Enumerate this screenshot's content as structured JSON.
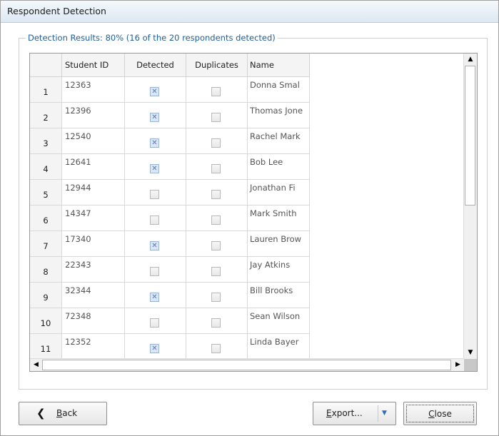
{
  "window": {
    "title": "Respondent Detection"
  },
  "group": {
    "legend": "Detection Results: 80% (16 of the 20 respondents detected)"
  },
  "table": {
    "headers": {
      "row_num": "",
      "student_id": "Student ID",
      "detected": "Detected",
      "duplicates": "Duplicates",
      "name": "Name"
    },
    "rows": [
      {
        "n": "1",
        "id": "12363",
        "detected": true,
        "duplicate": false,
        "name": "Donna Smal"
      },
      {
        "n": "2",
        "id": "12396",
        "detected": true,
        "duplicate": false,
        "name": "Thomas Jone"
      },
      {
        "n": "3",
        "id": "12540",
        "detected": true,
        "duplicate": false,
        "name": "Rachel Mark"
      },
      {
        "n": "4",
        "id": "12641",
        "detected": true,
        "duplicate": false,
        "name": "Bob Lee"
      },
      {
        "n": "5",
        "id": "12944",
        "detected": false,
        "duplicate": false,
        "name": "Jonathan Fi"
      },
      {
        "n": "6",
        "id": "14347",
        "detected": false,
        "duplicate": false,
        "name": "Mark Smith"
      },
      {
        "n": "7",
        "id": "17340",
        "detected": true,
        "duplicate": false,
        "name": "Lauren Brow"
      },
      {
        "n": "8",
        "id": "22343",
        "detected": false,
        "duplicate": false,
        "name": "Jay Atkins"
      },
      {
        "n": "9",
        "id": "32344",
        "detected": true,
        "duplicate": false,
        "name": "Bill Brooks"
      },
      {
        "n": "10",
        "id": "72348",
        "detected": false,
        "duplicate": false,
        "name": "Sean Wilson"
      },
      {
        "n": "11",
        "id": "12352",
        "detected": true,
        "duplicate": false,
        "name": "Linda Bayer"
      }
    ]
  },
  "buttons": {
    "back": {
      "label_key": "B",
      "label_rest": "ack",
      "icon": "chevron-left-icon"
    },
    "export": {
      "label_key": "E",
      "label_rest": "xport...",
      "dropdown_icon": "caret-down-icon"
    },
    "close": {
      "label_key": "C",
      "label_rest": "lose"
    }
  },
  "colors": {
    "legend": "#1f5f9a",
    "check_mark": "#4f7dbd",
    "dropdown_caret": "#2f6db5"
  }
}
